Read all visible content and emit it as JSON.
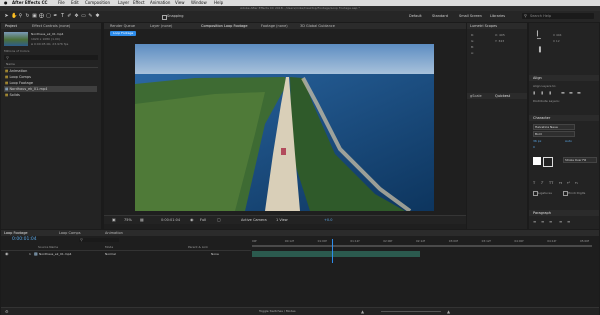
{
  "menubar": {
    "apple": "",
    "items": [
      "After Effects CC",
      "File",
      "Edit",
      "Composition",
      "Layer",
      "Effect",
      "Animation",
      "View",
      "Window",
      "Help"
    ]
  },
  "title": "Adobe After Effects CC 2018 - /Users/mike/Desktop/Footage/Loop Footage.aep *",
  "toolbar": {
    "snapping_label": "Snapping",
    "workspaces": [
      "Default",
      "Standard",
      "Small Screen",
      "Libraries"
    ],
    "search_placeholder": "Search Help"
  },
  "project_panel": {
    "tab": "Project",
    "effect_tab": "Effect Controls (none)",
    "footage_name": "Nordhaus_ek_01.mp4",
    "footage_info": "1920 x 1080 (1.00)",
    "footage_info2": "Δ 0:00:05:00, 23.976 fps",
    "footage_info3": "Millions of Colors",
    "search_placeholder": "",
    "column_name": "Name",
    "items": [
      {
        "name": "Animation"
      },
      {
        "name": "Loop Comps"
      },
      {
        "name": "Loop Footage"
      },
      {
        "name": "Nordhaus_ek_01.mp4"
      },
      {
        "name": "Solids"
      }
    ]
  },
  "comp_panel": {
    "tabs": [
      "Render Queue",
      "Layer (none)",
      "Composition Loop Footage",
      "Footage (none)",
      "3D Global Guidance"
    ],
    "breadcrumb": "Loop Footage",
    "zoom": "75%",
    "timecode": "0:00:01:04",
    "resolution": "Full",
    "camera": "Active Camera",
    "views": "1 View",
    "exposure": "+0.0"
  },
  "info_panel": {
    "tab": "Lumetri Scopes",
    "r": "R:",
    "g": "G:",
    "b": "B:",
    "a": "A:",
    "x": "X: 405",
    "y": "Y: 343"
  },
  "right_panels": {
    "align_tab": "Align",
    "align_to_label": "Align Layers to:",
    "distribute_label": "Distribute Layers:",
    "character_tab": "Character",
    "font": "Helvetica Neue",
    "style": "Bold",
    "size": "36 px",
    "leading": "Auto",
    "tracking": "0",
    "stroke": "Stroke Over Fill",
    "ligatures": "Ligatures",
    "hindi": "Hindi Digits",
    "paragraph_tab": "Paragraph"
  },
  "preview_tabs": {
    "a": "gScale",
    "b": "Quickest"
  },
  "timeline": {
    "tabs": [
      "Loop Footage",
      "Loop Comps",
      "Animation"
    ],
    "timecode": "0:00:01:04",
    "column_source": "Source Name",
    "column_mode": "Mode",
    "column_parent": "Parent & Link",
    "layer_index": "1",
    "layer_name": "Nordhaus_ek_01.mp4",
    "layer_mode": "Normal",
    "layer_parent": "None",
    "ruler": [
      "00f",
      "00:12f",
      "01:00f",
      "01:12f",
      "02:00f",
      "02:12f",
      "03:00f",
      "03:12f",
      "04:00f",
      "04:12f",
      "05:00f"
    ],
    "playhead_fraction": 0.24,
    "toggle_label": "Toggle Switches / Modes"
  },
  "colors": {
    "accent": "#2d8ceb",
    "timecode_blue": "#5aa7e6",
    "layer_bar": "#2b5a4e",
    "bg": "#1b1b1b"
  }
}
